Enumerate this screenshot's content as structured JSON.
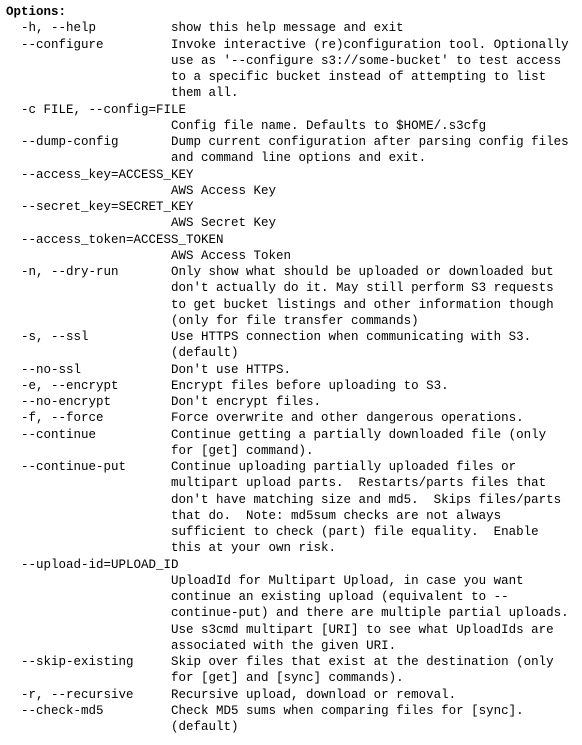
{
  "section_title": "Options:",
  "entries": [
    {
      "kind": "option",
      "flags": "  -h, --help          ",
      "desc": "show this help message and exit"
    },
    {
      "kind": "option",
      "flags": "  --configure         ",
      "desc": "Invoke interactive (re)configuration tool. Optionally use as '--configure s3://some-bucket' to test access to a specific bucket instead of attempting to list them all."
    },
    {
      "kind": "header",
      "flags": "  -c FILE, --config=FILE"
    },
    {
      "kind": "option",
      "flags": "                      ",
      "desc": "Config file name. Defaults to $HOME/.s3cfg"
    },
    {
      "kind": "option",
      "flags": "  --dump-config       ",
      "desc": "Dump current configuration after parsing config files and command line options and exit."
    },
    {
      "kind": "header",
      "flags": "  --access_key=ACCESS_KEY"
    },
    {
      "kind": "option",
      "flags": "                      ",
      "desc": "AWS Access Key"
    },
    {
      "kind": "header",
      "flags": "  --secret_key=SECRET_KEY"
    },
    {
      "kind": "option",
      "flags": "                      ",
      "desc": "AWS Secret Key"
    },
    {
      "kind": "header",
      "flags": "  --access_token=ACCESS_TOKEN"
    },
    {
      "kind": "option",
      "flags": "                      ",
      "desc": "AWS Access Token"
    },
    {
      "kind": "option",
      "flags": "  -n, --dry-run       ",
      "desc": "Only show what should be uploaded or downloaded but don't actually do it. May still perform S3 requests to get bucket listings and other information though (only for file transfer commands)"
    },
    {
      "kind": "option",
      "flags": "  -s, --ssl           ",
      "desc": "Use HTTPS connection when communicating with S3. (default)"
    },
    {
      "kind": "option",
      "flags": "  --no-ssl            ",
      "desc": "Don't use HTTPS."
    },
    {
      "kind": "option",
      "flags": "  -e, --encrypt       ",
      "desc": "Encrypt files before uploading to S3."
    },
    {
      "kind": "option",
      "flags": "  --no-encrypt        ",
      "desc": "Don't encrypt files."
    },
    {
      "kind": "option",
      "flags": "  -f, --force         ",
      "desc": "Force overwrite and other dangerous operations."
    },
    {
      "kind": "option",
      "flags": "  --continue          ",
      "desc": "Continue getting a partially downloaded file (only for [get] command)."
    },
    {
      "kind": "option",
      "flags": "  --continue-put      ",
      "desc": "Continue uploading partially uploaded files or multipart upload parts.  Restarts/parts files that don't have matching size and md5.  Skips files/parts that do.  Note: md5sum checks are not always sufficient to check (part) file equality.  Enable this at your own risk."
    },
    {
      "kind": "header",
      "flags": "  --upload-id=UPLOAD_ID"
    },
    {
      "kind": "option",
      "flags": "                      ",
      "desc": "UploadId for Multipart Upload, in case you want continue an existing upload (equivalent to --continue-put) and there are multiple partial uploads.  Use s3cmd multipart [URI] to see what UploadIds are associated with the given URI."
    },
    {
      "kind": "option",
      "flags": "  --skip-existing     ",
      "desc": "Skip over files that exist at the destination (only for [get] and [sync] commands)."
    },
    {
      "kind": "option",
      "flags": "  -r, --recursive     ",
      "desc": "Recursive upload, download or removal."
    },
    {
      "kind": "option",
      "flags": "  --check-md5         ",
      "desc": "Check MD5 sums when comparing files for [sync]. (default)"
    }
  ]
}
